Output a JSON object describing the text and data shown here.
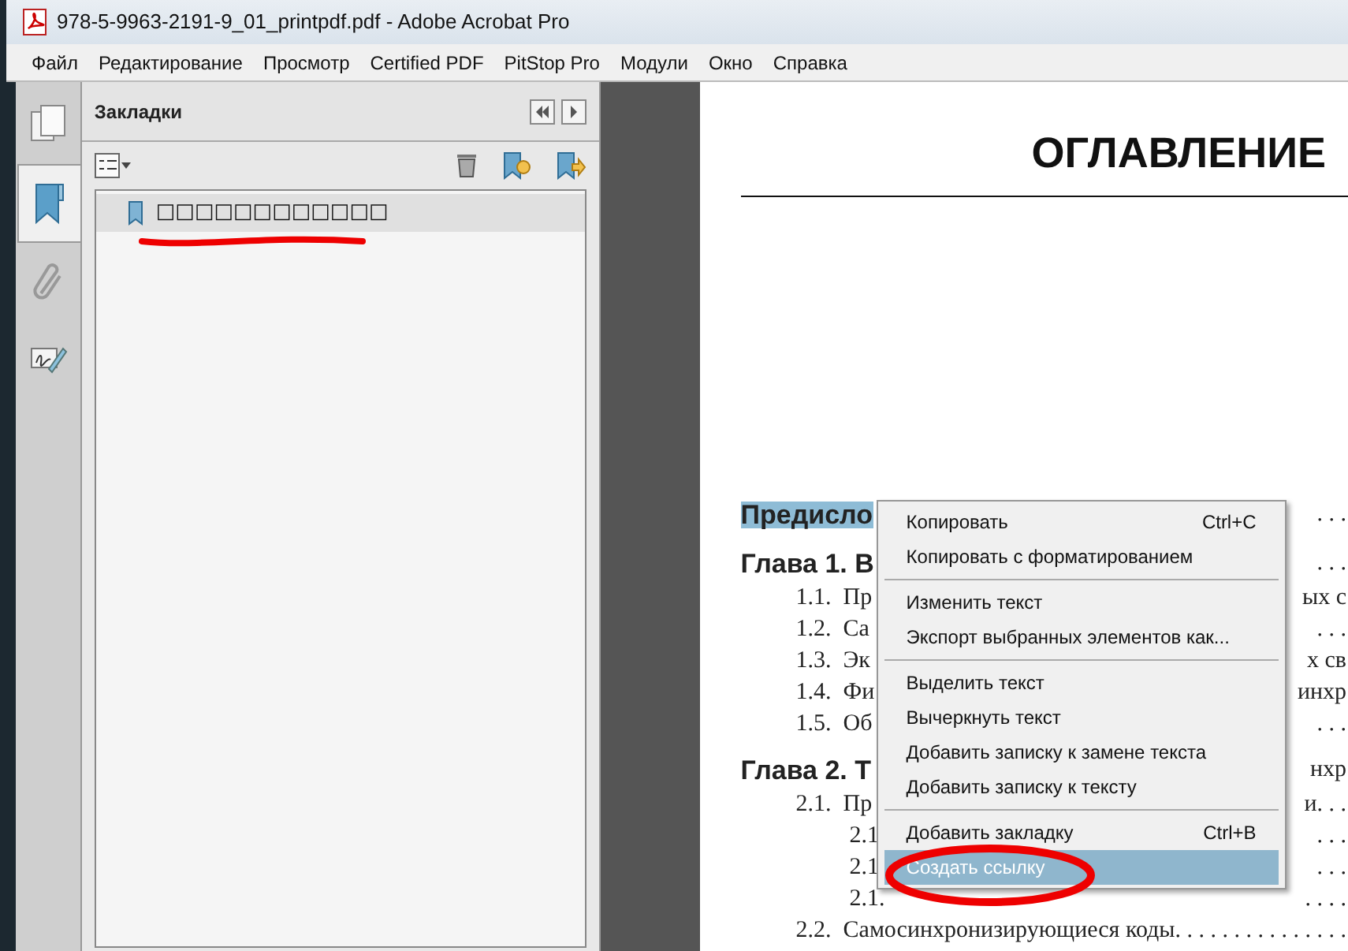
{
  "window": {
    "title": "978-5-9963-2191-9_01_printpdf.pdf - Adobe Acrobat Pro"
  },
  "menu_bar": [
    "Файл",
    "Редактирование",
    "Просмотр",
    "Certified PDF",
    "PitStop Pro",
    "Модули",
    "Окно",
    "Справка"
  ],
  "side_tabs": [
    {
      "kind": "pages",
      "selected": false
    },
    {
      "kind": "bookmarks",
      "selected": true
    },
    {
      "kind": "attachments",
      "selected": false
    },
    {
      "kind": "signatures",
      "selected": false
    }
  ],
  "bookmarks_panel": {
    "title": "Закладки",
    "items": [
      {
        "label": "□□□□□□□□□□□□",
        "selected": true
      }
    ]
  },
  "document": {
    "heading": "ОГЛАВЛЕНИЕ",
    "toc": [
      {
        "kind": "chapter",
        "text": "Предисло",
        "highlighted": true,
        "tail": ". . ."
      },
      {
        "kind": "chapter",
        "text": "Глава 1. В",
        "highlighted": false,
        "tail": ". . ."
      },
      {
        "kind": "section",
        "text": "1.1.  Пр",
        "highlighted": false,
        "tail": "ых с"
      },
      {
        "kind": "section",
        "text": "1.2.  Са",
        "highlighted": false,
        "tail": ". . ."
      },
      {
        "kind": "section",
        "text": "1.3.  Эк",
        "highlighted": false,
        "tail": "х св"
      },
      {
        "kind": "section",
        "text": "1.4.  Фи",
        "highlighted": false,
        "tail": "инхр"
      },
      {
        "kind": "section",
        "text": "1.5.  Об",
        "highlighted": false,
        "tail": ". . ."
      },
      {
        "kind": "chapter",
        "text": "Глава 2. Т",
        "highlighted": false,
        "tail": "нхр"
      },
      {
        "kind": "section",
        "text": "2.1.  Пр",
        "highlighted": false,
        "tail": "и. . ."
      },
      {
        "kind": "subsection",
        "text": "2.1",
        "highlighted": false,
        "tail": ". . ."
      },
      {
        "kind": "subsection",
        "text": "2.1",
        "highlighted": false,
        "tail": ". . ."
      },
      {
        "kind": "subsection",
        "text": "2.1.",
        "highlighted": false,
        "tail": ". . . ."
      },
      {
        "kind": "section",
        "text": "2.2.  Самосинхронизирующиеся коды",
        "highlighted": false,
        "tail": ". . . . . . . . . . . . . . ."
      }
    ]
  },
  "context_menu": {
    "groups": [
      [
        {
          "label": "Копировать",
          "shortcut": "Ctrl+C",
          "selected": false
        },
        {
          "label": "Копировать с форматированием",
          "selected": false
        }
      ],
      [
        {
          "label": "Изменить текст",
          "selected": false
        },
        {
          "label": "Экспорт выбранных элементов как...",
          "selected": false
        }
      ],
      [
        {
          "label": "Выделить текст",
          "selected": false
        },
        {
          "label": "Вычеркнуть текст",
          "selected": false
        },
        {
          "label": "Добавить записку к замене текста",
          "selected": false
        },
        {
          "label": "Добавить записку к тексту",
          "selected": false
        }
      ],
      [
        {
          "label": "Добавить закладку",
          "shortcut": "Ctrl+B",
          "selected": false
        },
        {
          "label": "Создать ссылку",
          "selected": true
        }
      ]
    ]
  }
}
